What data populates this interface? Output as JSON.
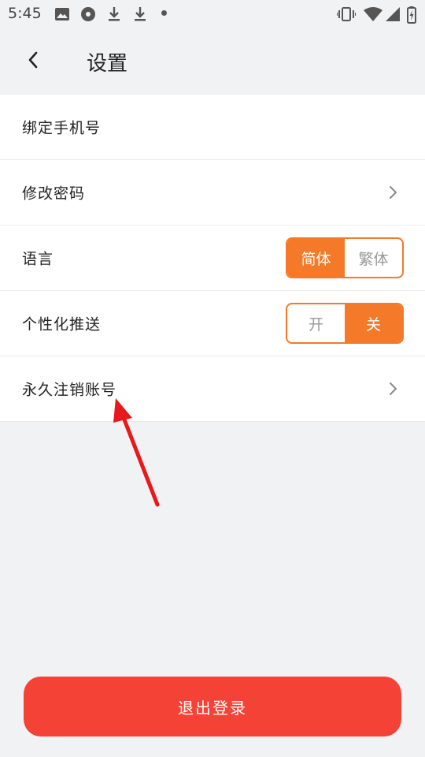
{
  "status_bar": {
    "time": "5:45"
  },
  "header": {
    "title": "设置"
  },
  "settings": {
    "bind_phone": "绑定手机号",
    "change_password": "修改密码",
    "language": {
      "label": "语言",
      "options": [
        "简体",
        "繁体"
      ],
      "selected": "简体"
    },
    "push": {
      "label": "个性化推送",
      "options": [
        "开",
        "关"
      ],
      "selected": "关"
    },
    "delete_account": "永久注销账号"
  },
  "logout": {
    "label": "退出登录"
  },
  "colors": {
    "accent": "#f47a2a",
    "logout": "#f44336",
    "annotation": "#e8191c"
  },
  "icons": [
    "photo-icon",
    "disc-icon",
    "download-icon",
    "vibrate-icon",
    "wifi-icon",
    "signal-icon",
    "battery-icon",
    "back-arrow-icon",
    "chevron-right-icon"
  ]
}
